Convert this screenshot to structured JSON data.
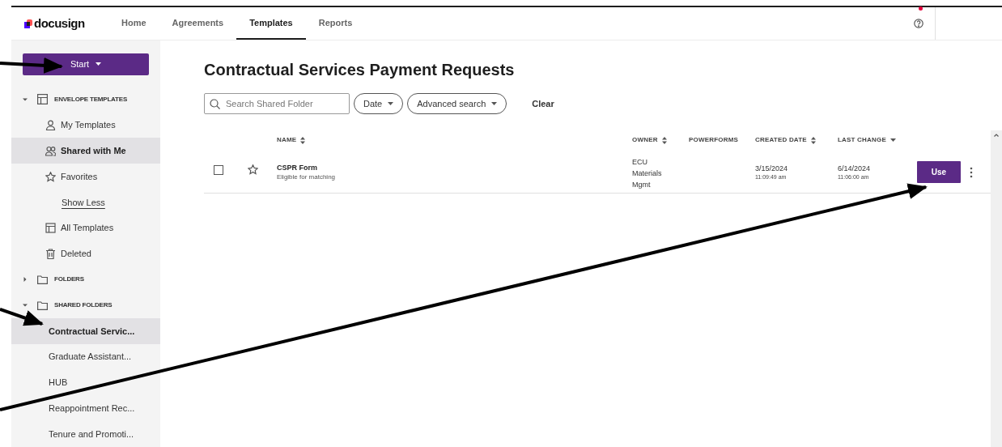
{
  "header": {
    "logo": "docusign",
    "nav": [
      {
        "label": "Home",
        "selected": false
      },
      {
        "label": "Agreements",
        "selected": false
      },
      {
        "label": "Templates",
        "selected": true
      },
      {
        "label": "Reports",
        "selected": false
      }
    ],
    "notification": true
  },
  "sidebar": {
    "start_button": "Start",
    "tree": [
      {
        "label": "ENVELOPE TEMPLATES",
        "kind": "section",
        "expanded": true,
        "children": [
          {
            "label": "My Templates",
            "kind": "item",
            "selected": false
          },
          {
            "label": "Shared with Me",
            "kind": "item",
            "selected": true
          },
          {
            "label": "Favorites",
            "kind": "item",
            "selected": false
          },
          {
            "label": "Show Less",
            "kind": "link",
            "selected": false
          },
          {
            "label": "All Templates",
            "kind": "item",
            "selected": false
          },
          {
            "label": "Deleted",
            "kind": "item",
            "selected": false
          }
        ]
      },
      {
        "label": "FOLDERS",
        "kind": "section",
        "expanded": false
      },
      {
        "label": "SHARED FOLDERS",
        "kind": "section",
        "expanded": true,
        "children": [
          {
            "label": "Contractual Servic...",
            "kind": "folder",
            "selected": true
          },
          {
            "label": "Graduate Assistant...",
            "kind": "folder",
            "selected": false
          },
          {
            "label": "HUB",
            "kind": "folder",
            "selected": false
          },
          {
            "label": "Reappointment Rec...",
            "kind": "folder",
            "selected": false
          },
          {
            "label": "Tenure and Promoti...",
            "kind": "folder",
            "selected": false
          }
        ]
      }
    ]
  },
  "main": {
    "title": "Contractual Services Payment Requests",
    "search": {
      "placeholder": "Search Shared Folder"
    },
    "filters": [
      "Date",
      "Advanced search"
    ],
    "clear": "Clear",
    "table": {
      "columns": [
        {
          "label": "NAME",
          "sortable": true,
          "sorted": false
        },
        {
          "label": "OWNER",
          "sortable": true,
          "sorted": false
        },
        {
          "label": "POWERFORMS",
          "sortable": false,
          "sorted": false
        },
        {
          "label": "CREATED DATE",
          "sortable": true,
          "sorted": false
        },
        {
          "label": "LAST CHANGE",
          "sorted": true
        }
      ],
      "rows": [
        {
          "checked": false,
          "favorite": false,
          "name": "CSPR Form",
          "description": "Eligible for matching",
          "owner": "ECU Materials Mgmt",
          "created_date": "3/15/2024",
          "created_time": "11:09:49 am",
          "changed_date": "6/14/2024",
          "changed_time": "11:06:00 am",
          "action": "Use"
        }
      ]
    }
  }
}
